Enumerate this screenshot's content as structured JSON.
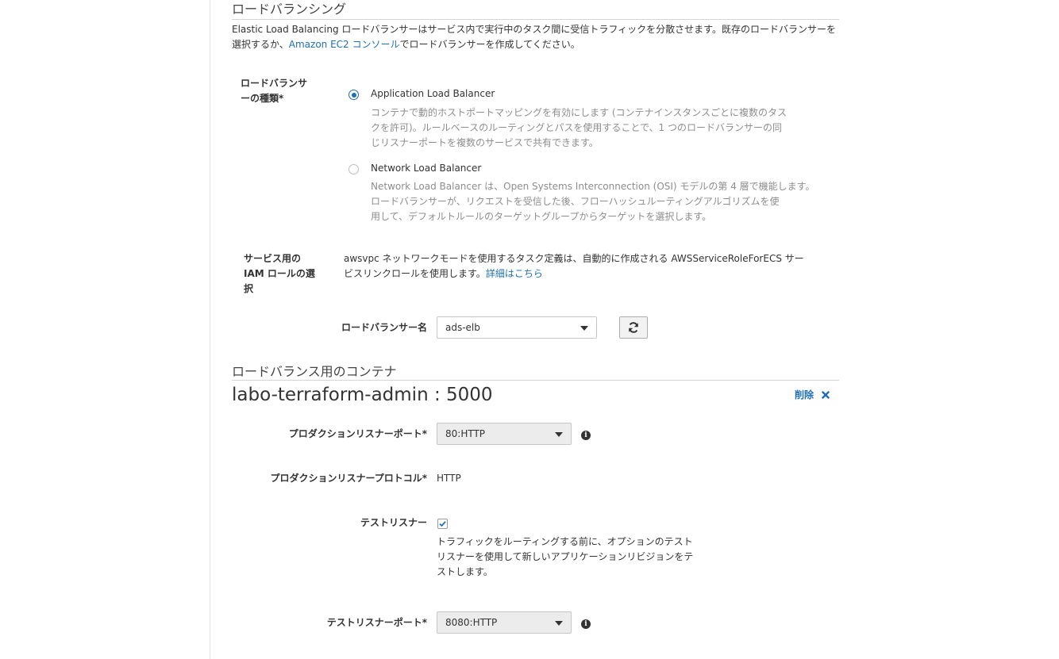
{
  "load_balancing": {
    "title": "ロードバランシング",
    "description_part1": "Elastic Load Balancing ロードバランサーはサービス内で実行中のタスク間に受信トラフィックを分散させます。既存のロードバランサーを選択するか、",
    "console_link": "Amazon EC2 コンソール",
    "description_part2": "でロードバランサーを作成してください。",
    "type_label_line1": "ロードバランサ",
    "type_label_line2": "ーの種類*",
    "options": [
      {
        "title": "Application Load Balancer",
        "desc_lines": [
          "コンテナで動的ホストポートマッピングを有効にします (コンテナインスタンスごとに複数のタス",
          "クを許可)。ルールベースのルーティングとパスを使用することで、1 つのロードバランサーの同",
          "じリスナーポートを複数のサービスで共有できます。"
        ],
        "selected": true
      },
      {
        "title": "Network Load Balancer",
        "desc_lines": [
          "Network Load Balancer は、Open Systems Interconnection (OSI) モデルの第 4 層で機能します。",
          "ロードバランサーが、リクエストを受信した後、フローハッシュルーティングアルゴリズムを使",
          "用して、デフォルトルールのターゲットグループからターゲットを選択します。"
        ],
        "selected": false
      }
    ],
    "iam_label_lines": [
      "サービス用の",
      "IAM ロールの選",
      "択"
    ],
    "iam_text_line1": "awsvpc ネットワークモードを使用するタスク定義は、自動的に作成される AWSServiceRoleForECS サー",
    "iam_text_line2": "ビスリンクロールを使用します。",
    "iam_link": "詳細はこちら",
    "lb_name_label": "ロードバランサー名",
    "lb_name_value": "ads-elb"
  },
  "container_section": {
    "title": "ロードバランス用のコンテナ",
    "container_heading": "labo-terraform-admin : 5000",
    "delete_label": "削除",
    "prod_port_label": "プロダクションリスナーポート*",
    "prod_port_value": "80:HTTP",
    "prod_protocol_label": "プロダクションリスナープロトコル*",
    "prod_protocol_value": "HTTP",
    "test_listener_label": "テストリスナー",
    "test_listener_checked": true,
    "test_listener_desc_lines": [
      "トラフィックをルーティングする前に、オプションのテスト",
      "リスナーを使用して新しいアプリケーションリビジョンをテ",
      "ストします。"
    ],
    "test_port_label": "テストリスナーポート*",
    "test_port_value": "8080:HTTP"
  },
  "icons": {
    "refresh": "refresh-icon",
    "info": "info-icon",
    "close": "close-icon",
    "check": "check-icon",
    "caret": "chevron-down-icon"
  },
  "colors": {
    "link": "#1f6fb3",
    "radio_selected": "#1f6fb3",
    "muted_text": "#8d8d8d"
  }
}
